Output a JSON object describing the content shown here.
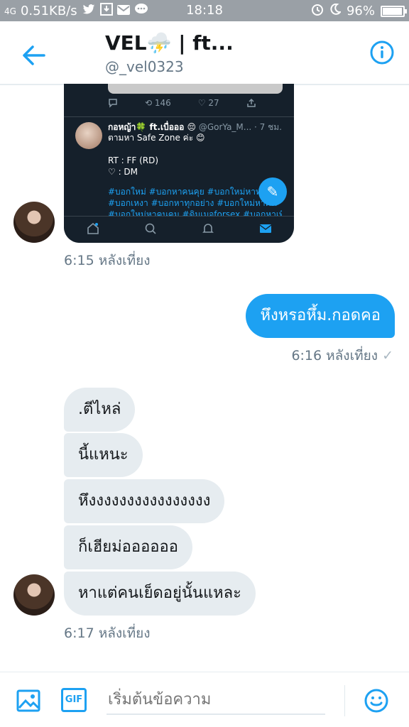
{
  "status_bar": {
    "network": "4G",
    "speed": "0.51KB/s",
    "time": "18:18",
    "battery": "96%",
    "battery_level": 0.96
  },
  "header": {
    "title": "VEL⛈️ | ft...",
    "handle": "@_vel0323",
    "back_icon": "back-arrow-icon",
    "info_icon": "info-icon"
  },
  "embedded_tweet": {
    "retweets": "146",
    "likes": "27",
    "author": "กอหญ้า🍀 ft.เบื่อออ 😔",
    "author_meta": " @GorYa_M... · 7 ชม.",
    "text": "ตามหา Safe Zone ค่ะ 😊\n\nRT : FF (RD)\n♡ : DM",
    "hashtags": "#บอกใหม่ #บอกหาคนคุย #บอกใหม่หาทุกอ\n#บอกเหงา #บอกหาทุกอย่าง #บอกใหม่หาคน\n#บอกใหม่หาคนคุม #ดิมเมจforsex #บอกหาเพื่อน"
  },
  "messages": {
    "time1": "6:15 หลังเที่ยง",
    "outgoing": "หึงหรอหึ้ม.กอดคอ",
    "time2": "6:16 หลังเที่ยง",
    "check": "✓",
    "incoming": [
      ".ตีไหล่",
      "นี้แหนะ",
      "หึงงงงงงงงงงงงงงงง",
      "ก็เฮียม่ออออออ",
      "หาแต่คนเย็ดอยู่นั้นแหละ"
    ],
    "time3": "6:17 หลังเที่ยง"
  },
  "composer": {
    "placeholder": "เริ่มต้นข้อความ",
    "gif_label": "GIF"
  },
  "colors": {
    "accent": "#1da1f2",
    "incoming_bubble": "#e6ecf0",
    "status_bar": "#9aa0a6"
  }
}
